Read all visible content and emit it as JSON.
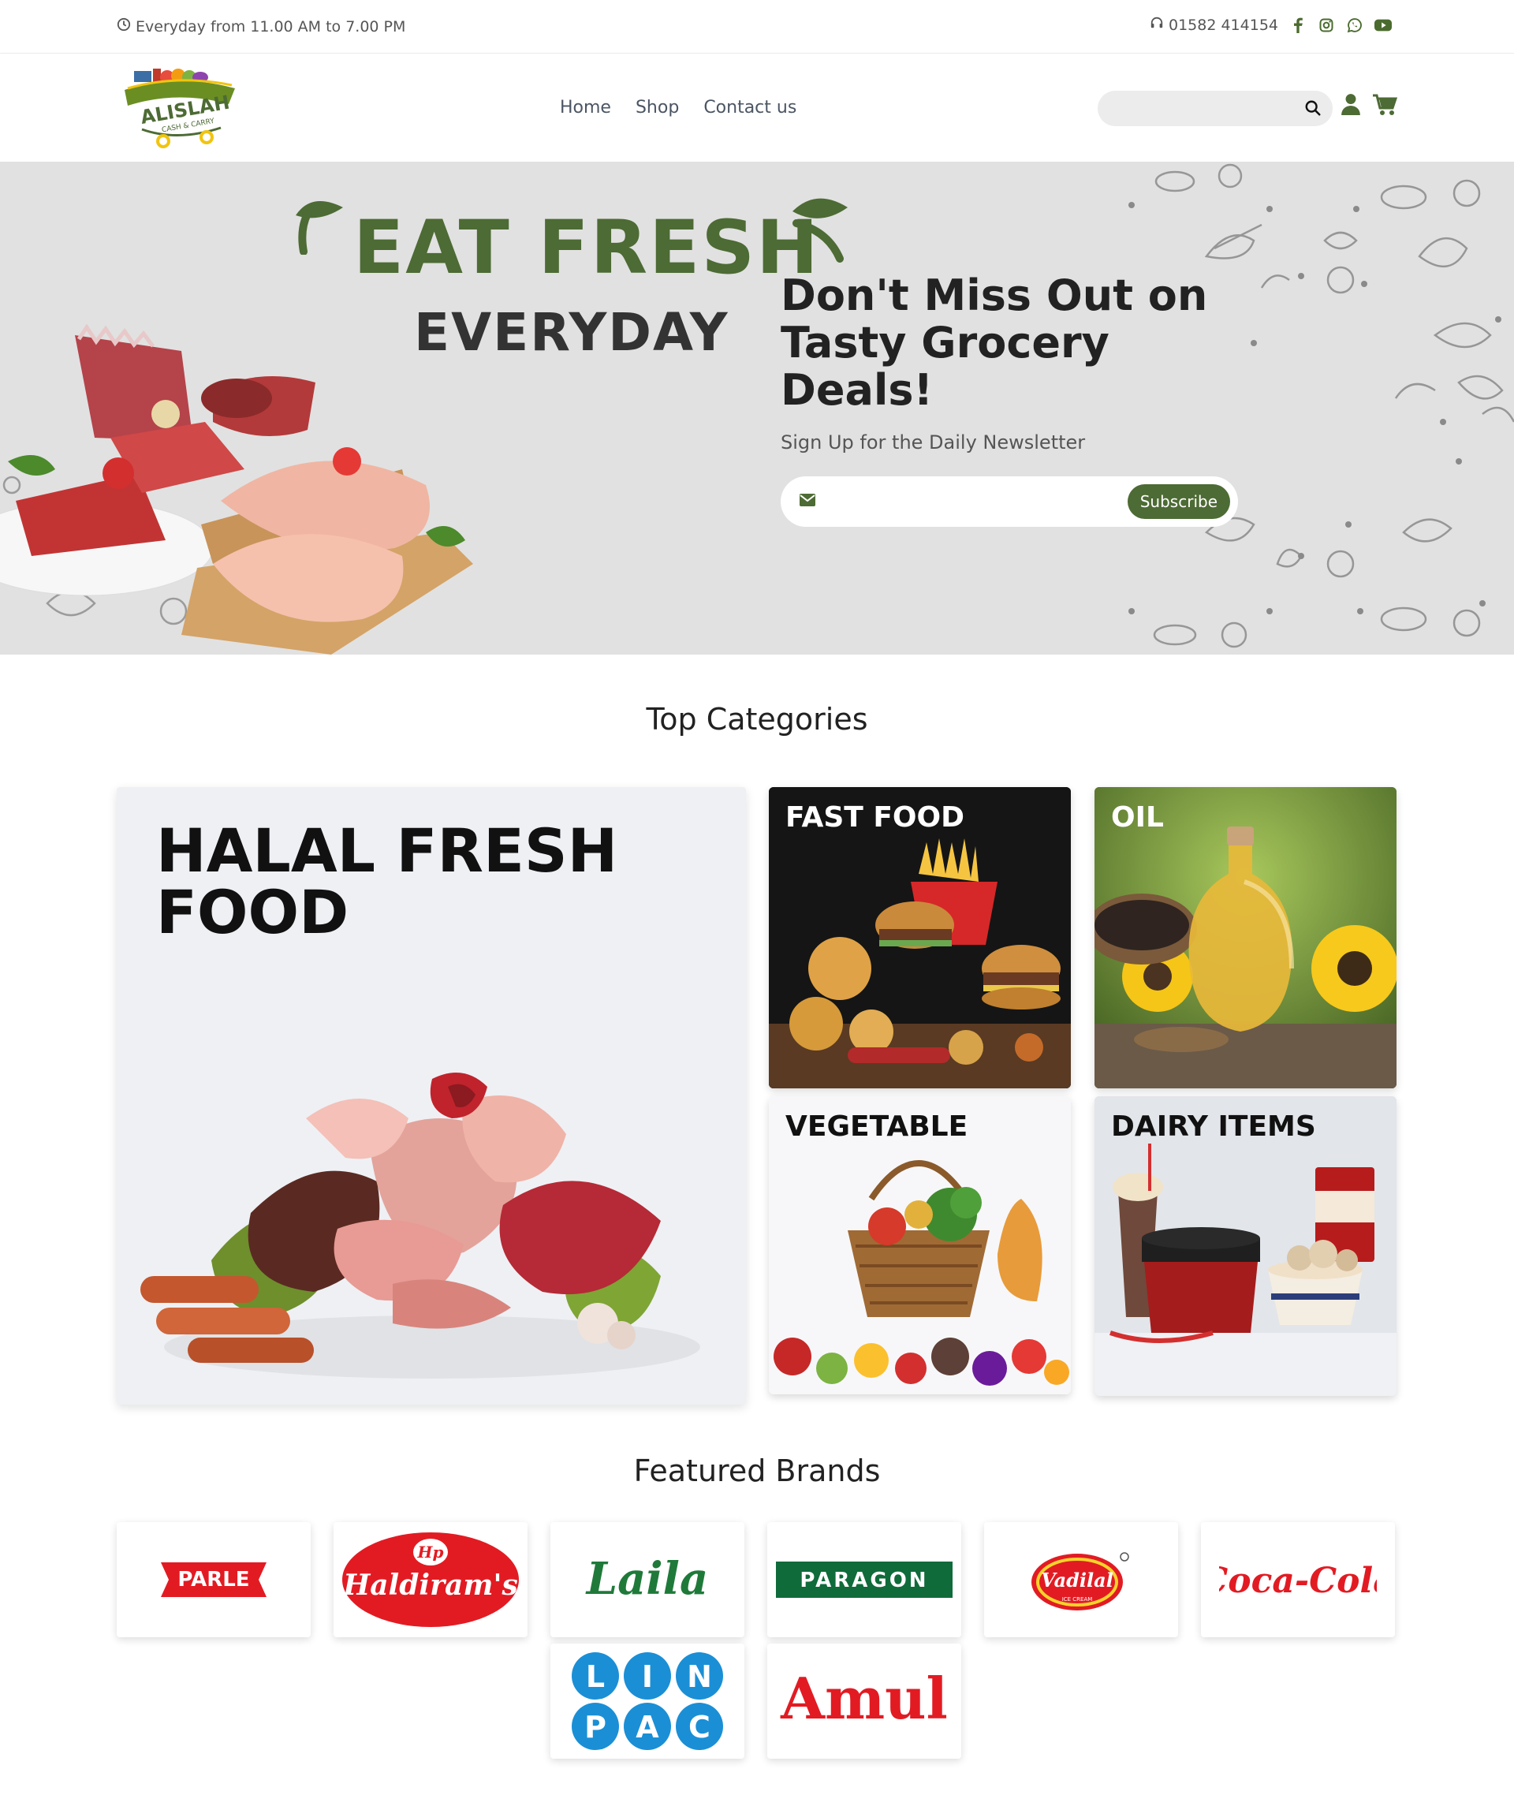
{
  "topbar": {
    "hours": "Everyday from 11.00 AM to 7.00 PM",
    "phone": "01582 414154",
    "social": [
      "facebook-icon",
      "instagram-icon",
      "whatsapp-icon",
      "youtube-icon"
    ]
  },
  "header": {
    "logo_text": "ALISLAH",
    "logo_sub": "CASH & CARRY",
    "nav": [
      "Home",
      "Shop",
      "Contact us"
    ],
    "search_placeholder": ""
  },
  "hero": {
    "headline": "EAT FRESH",
    "subheadline": "EVERYDAY",
    "deal_title": "Don't Miss Out on Tasty Grocery Deals!",
    "newsletter_label": "Sign Up for the Daily Newsletter",
    "email_placeholder": "",
    "subscribe_label": "Subscribe"
  },
  "categories": {
    "title": "Top Categories",
    "items": [
      {
        "label": "HALAL FRESH FOOD"
      },
      {
        "label": "FAST FOOD"
      },
      {
        "label": "OIL"
      },
      {
        "label": "VEGETABLE"
      },
      {
        "label": "DAIRY ITEMS"
      }
    ]
  },
  "brands": {
    "title": "Featured Brands",
    "items": [
      "PARLE",
      "Haldiram's",
      "Laila",
      "PARAGON",
      "Vadilal",
      "Coca-Cola",
      "LINPAC",
      "Amul"
    ],
    "linpac_letters": [
      "L",
      "I",
      "N",
      "P",
      "A",
      "C"
    ],
    "haldiram_mark": "Hp",
    "vadilal_sub": "ICE CREAM"
  },
  "colors": {
    "brand_green": "#4d6b34",
    "hero_bg": "#e1e1e1",
    "tile_bg": "#eef0f4"
  }
}
